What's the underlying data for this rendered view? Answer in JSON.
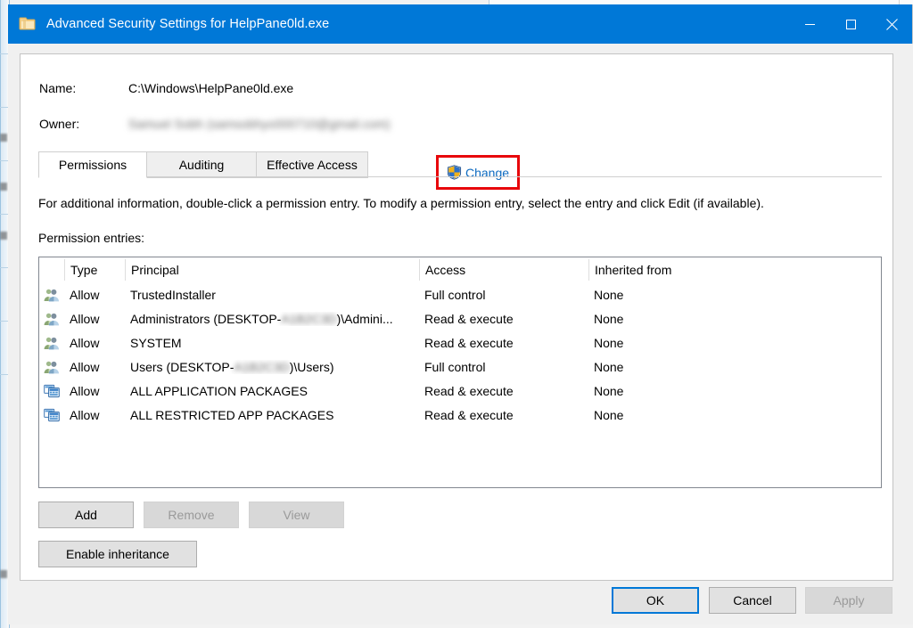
{
  "window": {
    "title": "Advanced Security Settings for HelpPane0ld.exe",
    "icon": "folder-icon",
    "titlebar_color": "#0078d7",
    "caption": {
      "minimize": "minimize-icon",
      "maximize": "maximize-icon",
      "close": "close-icon"
    }
  },
  "info": {
    "name_label": "Name:",
    "name_value": "C:\\Windows\\HelpPane0ld.exe",
    "owner_label": "Owner:",
    "owner_value_redacted": "Samuel Sobh (samsobhyo000710@gmail.com)",
    "change_link": "Change",
    "change_icon": "uac-shield-icon",
    "annotation_color": "#e8070b"
  },
  "tabs": [
    {
      "label": "Permissions",
      "active": true
    },
    {
      "label": "Auditing",
      "active": false
    },
    {
      "label": "Effective Access",
      "active": false
    }
  ],
  "main": {
    "description": "For additional information, double-click a permission entry. To modify a permission entry, select the entry and click Edit (if available).",
    "entries_label": "Permission entries:"
  },
  "table": {
    "columns": [
      "",
      "Type",
      "Principal",
      "Access",
      "Inherited from"
    ],
    "rows": [
      {
        "icon": "users-group-icon",
        "type": "Allow",
        "principal_pre": "TrustedInstaller",
        "principal_redacted": "",
        "principal_post": "",
        "access": "Full control",
        "inherited": "None"
      },
      {
        "icon": "users-group-icon",
        "type": "Allow",
        "principal_pre": "Administrators (DESKTOP-",
        "principal_redacted": "A1B2C3D",
        "principal_post": ")\\Admini...",
        "access": "Read & execute",
        "inherited": "None"
      },
      {
        "icon": "users-group-icon",
        "type": "Allow",
        "principal_pre": "SYSTEM",
        "principal_redacted": "",
        "principal_post": "",
        "access": "Read & execute",
        "inherited": "None"
      },
      {
        "icon": "users-group-icon",
        "type": "Allow",
        "principal_pre": "Users (DESKTOP-",
        "principal_redacted": "A1B2C3D",
        "principal_post": ")\\Users)",
        "access": "Full control",
        "inherited": "None"
      },
      {
        "icon": "app-package-icon",
        "type": "Allow",
        "principal_pre": "ALL APPLICATION PACKAGES",
        "principal_redacted": "",
        "principal_post": "",
        "access": "Read & execute",
        "inherited": "None"
      },
      {
        "icon": "app-package-icon",
        "type": "Allow",
        "principal_pre": "ALL RESTRICTED APP PACKAGES",
        "principal_redacted": "",
        "principal_post": "",
        "access": "Read & execute",
        "inherited": "None"
      }
    ]
  },
  "buttons": {
    "add": {
      "label": "Add",
      "enabled": true
    },
    "remove": {
      "label": "Remove",
      "enabled": false
    },
    "view": {
      "label": "View",
      "enabled": false
    },
    "enable_inheritance": {
      "label": "Enable inheritance",
      "enabled": true
    }
  },
  "footer": {
    "ok": {
      "label": "OK",
      "enabled": true,
      "default": true
    },
    "cancel": {
      "label": "Cancel",
      "enabled": true
    },
    "apply": {
      "label": "Apply",
      "enabled": false
    }
  }
}
